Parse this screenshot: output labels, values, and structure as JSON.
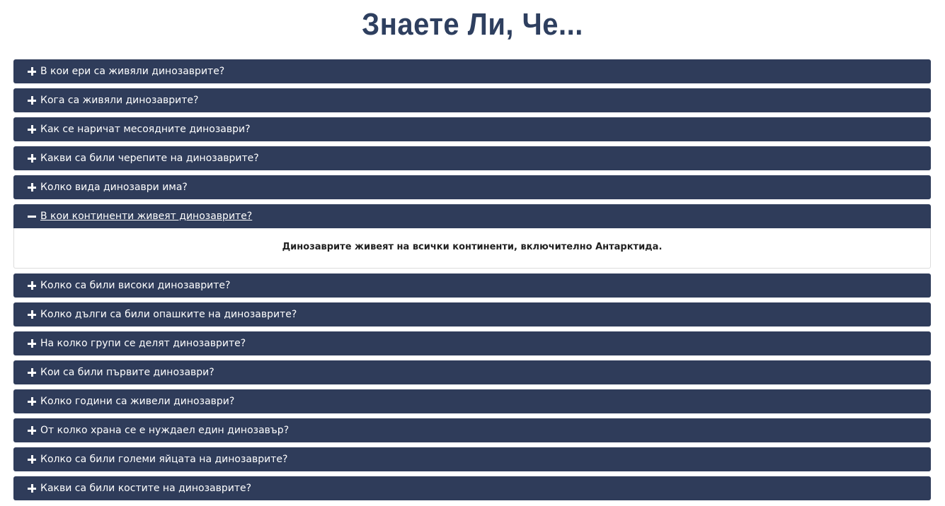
{
  "page": {
    "title": "Знаете Ли, Че..."
  },
  "accordion": {
    "items": [
      {
        "question": "В кои ери са живяли динозаврите?",
        "icon": "plus-icon",
        "expanded": false
      },
      {
        "question": "Кога са живяли динозаврите?",
        "icon": "plus-icon",
        "expanded": false
      },
      {
        "question": "Как се наричат месоядните динозаври?",
        "icon": "plus-icon",
        "expanded": false
      },
      {
        "question": "Какви са били черепите на динозаврите?",
        "icon": "plus-icon",
        "expanded": false
      },
      {
        "question": "Колко вида динозаври има?",
        "icon": "plus-icon",
        "expanded": false
      },
      {
        "question": "В кои континенти живеят динозаврите?",
        "icon": "minus-icon",
        "expanded": true,
        "answer": "Динозаврите живеят на всички континенти, включително Антарктида."
      },
      {
        "question": "Колко са били високи динозаврите?",
        "icon": "plus-icon",
        "expanded": false
      },
      {
        "question": "Колко дълги са били опашките на динозаврите?",
        "icon": "plus-icon",
        "expanded": false
      },
      {
        "question": "На колко групи се делят динозаврите?",
        "icon": "plus-icon",
        "expanded": false
      },
      {
        "question": "Кои са били първите динозаври?",
        "icon": "plus-icon",
        "expanded": false
      },
      {
        "question": "Колко години са живели динозаври?",
        "icon": "plus-icon",
        "expanded": false
      },
      {
        "question": "От колко храна се е нуждаел един динозавър?",
        "icon": "plus-icon",
        "expanded": false
      },
      {
        "question": "Колко са били големи яйцата на динозаврите?",
        "icon": "plus-icon",
        "expanded": false
      },
      {
        "question": "Какви са били костите на динозаврите?",
        "icon": "plus-icon",
        "expanded": false
      }
    ]
  },
  "colors": {
    "title": "#2e3f5f",
    "header_bg": "#2f3c5a",
    "header_text": "#ffffff",
    "answer_text": "#222222"
  }
}
